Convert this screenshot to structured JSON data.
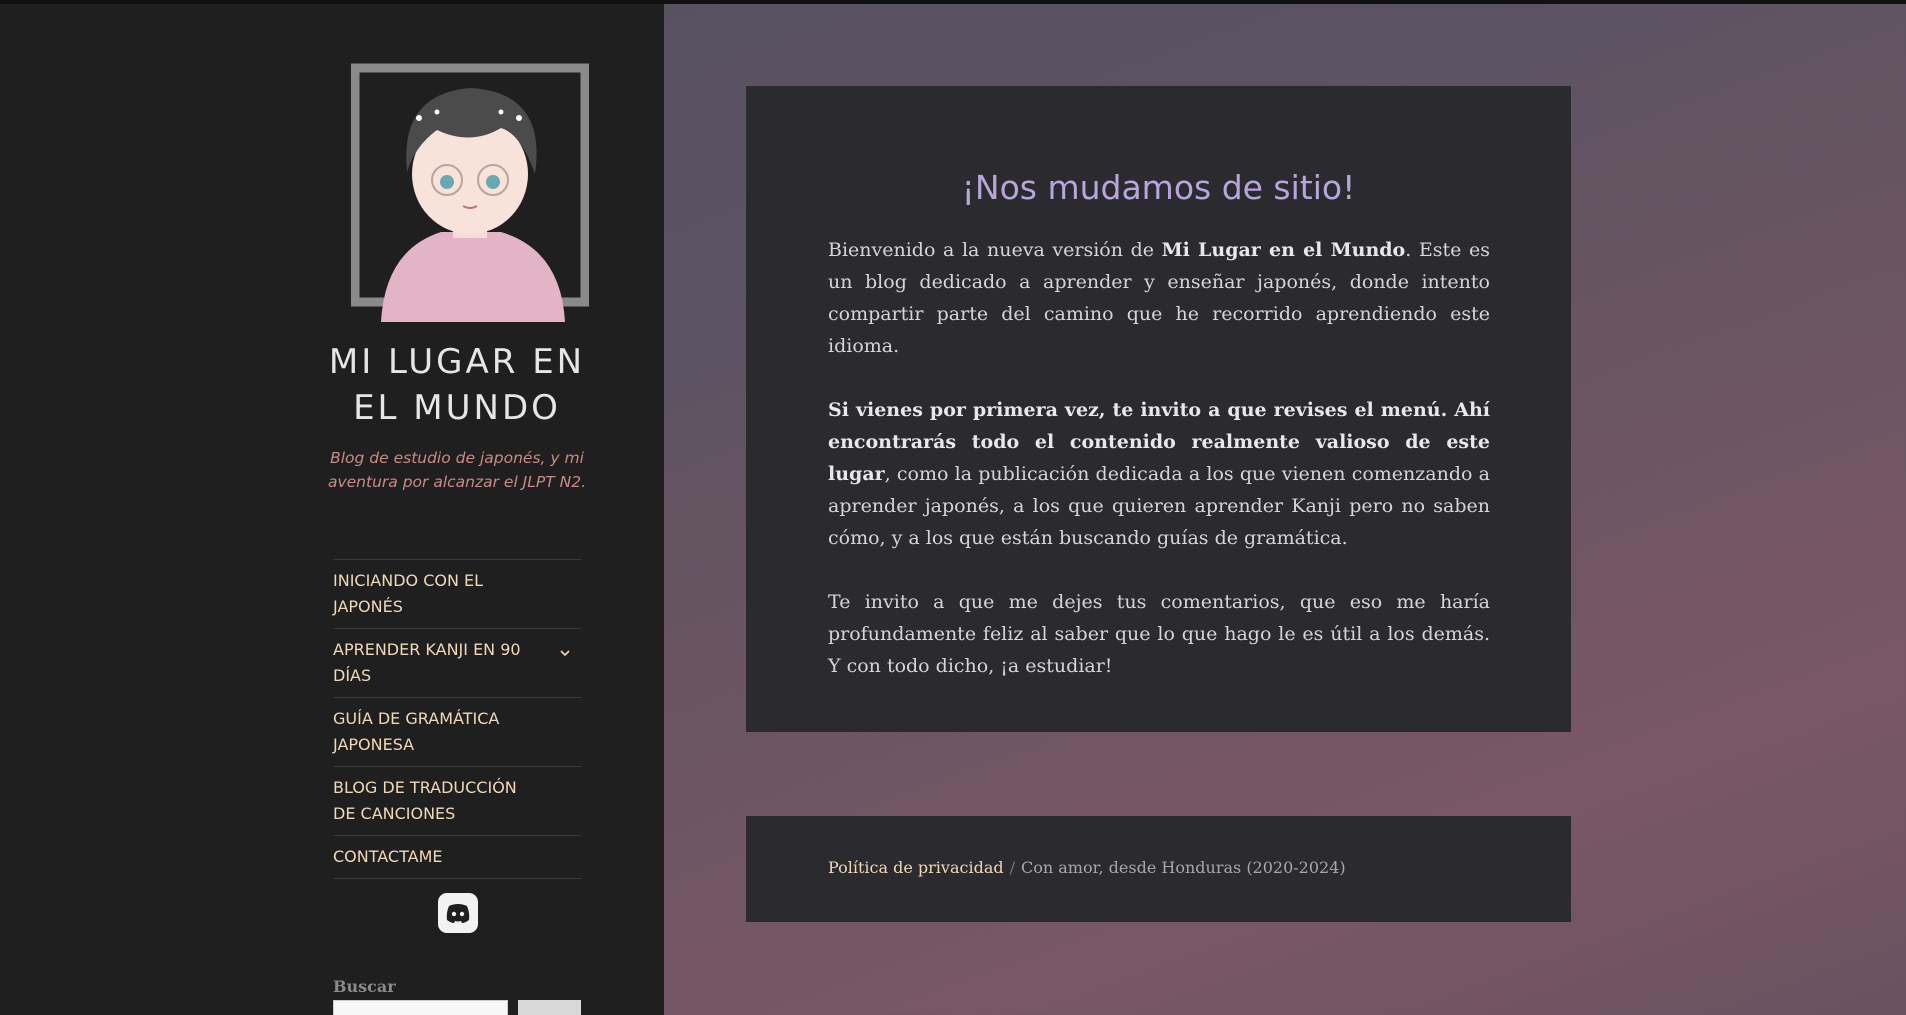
{
  "site": {
    "title": "MI LUGAR EN EL MUNDO",
    "description": "Blog de estudio de japonés, y mi aventura por alcanzar el JLPT N2."
  },
  "nav": [
    {
      "label": "INICIANDO CON EL JAPONÉS"
    },
    {
      "label": "APRENDER KANJI EN 90 DÍAS",
      "has_submenu": true
    },
    {
      "label": "GUÍA DE GRAMÁTICA JAPONESA"
    },
    {
      "label": "BLOG DE TRADUCCIÓN DE CANCIONES"
    },
    {
      "label": "CONTACTAME"
    }
  ],
  "search": {
    "label": "Buscar"
  },
  "post": {
    "title": "¡Nos mudamos de sitio!",
    "p1_pre": "Bienvenido a la nueva versión de ",
    "p1_bold": "Mi Lugar en el Mundo",
    "p1_post": ". Este es un blog dedicado a aprender y enseñar japonés, donde intento compartir parte del camino que he recorrido aprendiendo este idioma.",
    "p2_bold": "Si vienes por primera vez, te invito a que revises el menú. Ahí encontrarás todo el contenido realmente valioso de este lugar",
    "p2_post": ", como la publicación dedicada a los que vienen comenzando a aprender japonés, a los que quieren aprender Kanji pero no saben cómo, y a los que están buscando guías de gramática.",
    "p3": "Te invito a que me dejes tus comentarios, que eso me haría profundamente feliz al saber que lo que hago le es útil a los demás. Y con todo dicho, ¡a estudiar!"
  },
  "footer": {
    "privacy": "Política de privacidad",
    "separator": "/",
    "credit": "Con amor, desde Honduras (2020-2024)"
  },
  "icons": {
    "discord": "discord-icon",
    "submenu": "chevron-down-icon"
  }
}
